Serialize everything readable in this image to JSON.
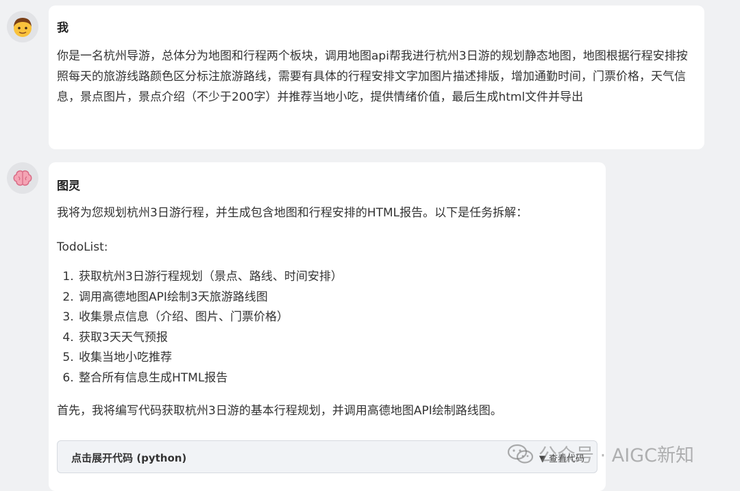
{
  "user_message": {
    "sender": "我",
    "text": "你是一名杭州导游，总体分为地图和行程两个板块，调用地图api帮我进行杭州3日游的规划静态地图，地图根据行程安排按照每天的旅游线路颜色区分标注旅游路线，需要有具体的行程安排文字加图片描述排版，增加通勤时间，门票价格，天气信息，景点图片，景点介绍（不少于200字）并推荐当地小吃，提供情绪价值，最后生成html文件并导出"
  },
  "assistant_message": {
    "sender": "图灵",
    "intro": "我将为您规划杭州3日游行程，并生成包含地图和行程安排的HTML报告。以下是任务拆解：",
    "todo_title": "TodoList:",
    "todo_items": [
      "获取杭州3日游行程规划（景点、路线、时间安排）",
      "调用高德地图API绘制3天旅游路线图",
      "收集景点信息（介绍、图片、门票价格）",
      "获取3天天气预报",
      "收集当地小吃推荐",
      "整合所有信息生成HTML报告"
    ],
    "outro": "首先，我将编写代码获取杭州3日游的基本行程规划，并调用高德地图API绘制路线图。",
    "code_block": {
      "label": "点击展开代码 (python)",
      "toggle": "▼ 查看代码"
    }
  },
  "watermark": {
    "text": "公众号 · AIGC新知"
  },
  "icons": {
    "user_avatar": "boy-face-icon",
    "assistant_avatar": "brain-icon",
    "watermark_icon": "wechat-icon"
  }
}
